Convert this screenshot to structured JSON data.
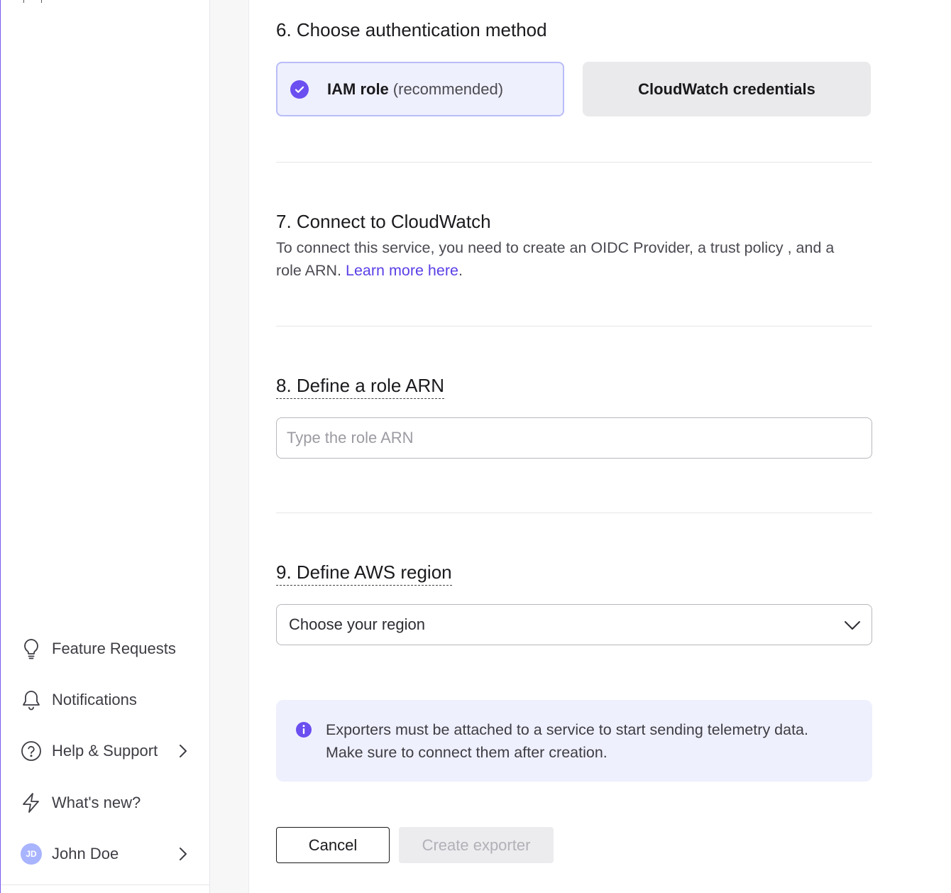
{
  "sidebar": {
    "items": [
      {
        "id": "feature-requests",
        "label": "Feature Requests",
        "icon": "lightbulb-icon"
      },
      {
        "id": "notifications",
        "label": "Notifications",
        "icon": "bell-icon"
      },
      {
        "id": "help-support",
        "label": "Help & Support",
        "icon": "question-circle-icon",
        "has_chevron": true
      },
      {
        "id": "whats-new",
        "label": "What's new?",
        "icon": "lightning-icon"
      }
    ],
    "user": {
      "initials": "JD",
      "name": "John Doe"
    }
  },
  "auth": {
    "heading": "6. Choose authentication method",
    "options": [
      {
        "title": "IAM role",
        "subtitle": "(recommended)",
        "selected": true
      },
      {
        "title": "CloudWatch credentials",
        "selected": false
      }
    ]
  },
  "connect": {
    "heading": "7. Connect to CloudWatch",
    "text": "To connect this service, you need to create an OIDC Provider, a trust policy , and a role ARN.",
    "link_text": "Learn more here",
    "suffix": "."
  },
  "role_arn": {
    "heading": "8. Define a role ARN",
    "placeholder": "Type the role ARN",
    "value": ""
  },
  "region": {
    "heading": "9. Define AWS region",
    "selected_text": "Choose your region"
  },
  "info": {
    "text": "Exporters must be attached to a service to start sending telemetry data. Make sure to connect them after creation."
  },
  "actions": {
    "cancel_label": "Cancel",
    "create_label": "Create exporter",
    "create_disabled": true
  },
  "colors": {
    "accent": "#6b4ff0",
    "link": "#5b3fe6",
    "selected_bg": "#eff0fd",
    "info_bg": "#eff0fd"
  }
}
